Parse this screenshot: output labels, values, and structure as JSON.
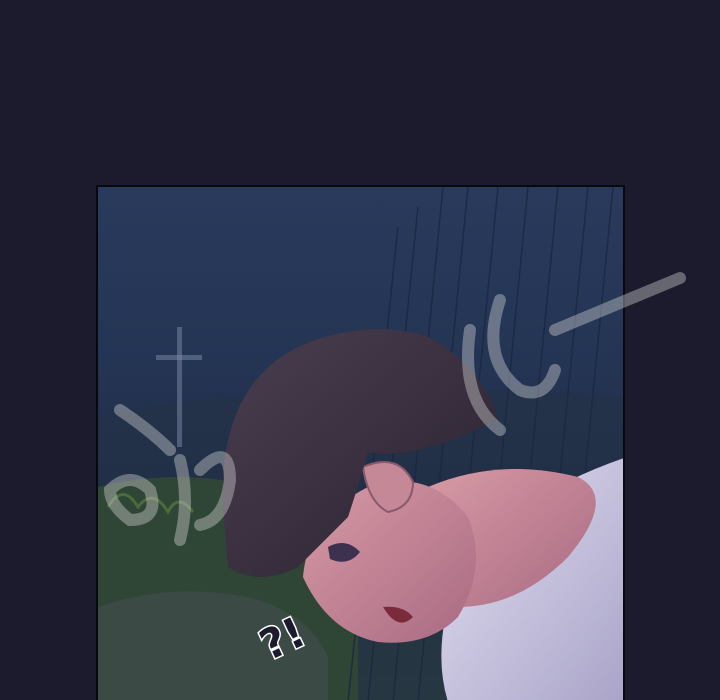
{
  "scene": {
    "description_icon": "manga-panel-icon",
    "colors": {
      "page_background": "#1b1b2d",
      "night_sky": "#2a3a5c",
      "hair": "#3a2f3d",
      "skin": "#c98a9a",
      "shirt": "#cfcbe6",
      "watermark": "#d8d8d8"
    }
  },
  "sound_effect": {
    "text": "?!"
  }
}
